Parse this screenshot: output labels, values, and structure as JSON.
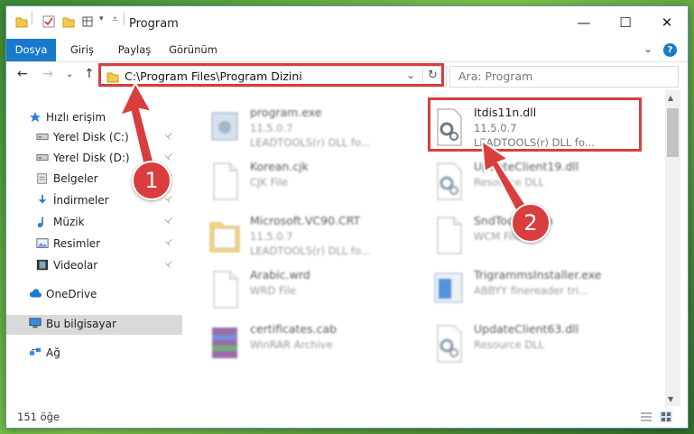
{
  "window": {
    "title": "Program",
    "controls": {
      "minimize": "—",
      "maximize": "☐",
      "close": "✕"
    }
  },
  "ribbon": {
    "tabs": [
      "Dosya",
      "Giriş",
      "Paylaş",
      "Görünüm"
    ],
    "expand_glyph": "⌄",
    "help_glyph": "?"
  },
  "address": {
    "path": "C:\\Program Files\\Program Dizini",
    "dropdown_glyph": "⌄",
    "refresh_glyph": "↻",
    "search_placeholder": "Ara: Program"
  },
  "nav": {
    "back": "←",
    "forward": "→",
    "recent": "⌄",
    "up": "↑",
    "items": [
      {
        "label": "Hızlı erişim",
        "icon": "star-icon",
        "pinned": false
      },
      {
        "label": "Yerel Disk (C:)",
        "icon": "drive-icon",
        "pinned": true
      },
      {
        "label": "Yerel Disk (D:)",
        "icon": "drive-icon",
        "pinned": true
      },
      {
        "label": "Belgeler",
        "icon": "documents-icon",
        "pinned": true
      },
      {
        "label": "İndirmeler",
        "icon": "download-icon",
        "pinned": true
      },
      {
        "label": "Müzik",
        "icon": "music-icon",
        "pinned": true
      },
      {
        "label": "Resimler",
        "icon": "pictures-icon",
        "pinned": true
      },
      {
        "label": "Videolar",
        "icon": "videos-icon",
        "pinned": true
      },
      {
        "label": "OneDrive",
        "icon": "cloud-icon",
        "pinned": false
      },
      {
        "label": "Bu bilgisayar",
        "icon": "computer-icon",
        "pinned": false,
        "selected": true
      },
      {
        "label": "Ağ",
        "icon": "network-icon",
        "pinned": false
      }
    ],
    "pin_glyph": "📌"
  },
  "files": [
    {
      "name": "program.exe",
      "l2": "11.5.0.7",
      "l3": "LEADTOOLS(r) DLL fo...",
      "icon": "exe-icon"
    },
    {
      "name": "Korean.cjk",
      "l2": "CJK File",
      "l3": "",
      "icon": "file-icon"
    },
    {
      "name": "Microsoft.VC90.CRT",
      "l2": "11.5.0.7",
      "l3": "LEADTOOLS(r) DLL fo...",
      "icon": "folder-icon"
    },
    {
      "name": "Arabic.wrd",
      "l2": "WRD File",
      "l3": "",
      "icon": "file-icon"
    },
    {
      "name": "certificates.cab",
      "l2": "WinRAR Archive",
      "l3": "",
      "icon": "archive-icon"
    },
    {
      "name": "Itdis11n.dll",
      "l2": "11.5.0.7",
      "l3": "LEADTOOLS(r) DLL fo...",
      "icon": "dll-icon"
    },
    {
      "name": "UpdateClient19.dll",
      "l2": "Resource DLL",
      "l3": "",
      "icon": "dll-icon"
    },
    {
      "name": "SndTools.wcm",
      "l2": "WCM File",
      "l3": "",
      "icon": "file-icon"
    },
    {
      "name": "TrigrammsInstaller.exe",
      "l2": "ABBYY finereader tri...",
      "l3": "",
      "icon": "installer-icon"
    },
    {
      "name": "UpdateClient63.dll",
      "l2": "Resource DLL",
      "l3": "",
      "icon": "dll-icon"
    }
  ],
  "status": {
    "count": "151 öğe"
  },
  "annotations": {
    "step1": "1",
    "step2": "2",
    "color": "#d93d3d"
  }
}
